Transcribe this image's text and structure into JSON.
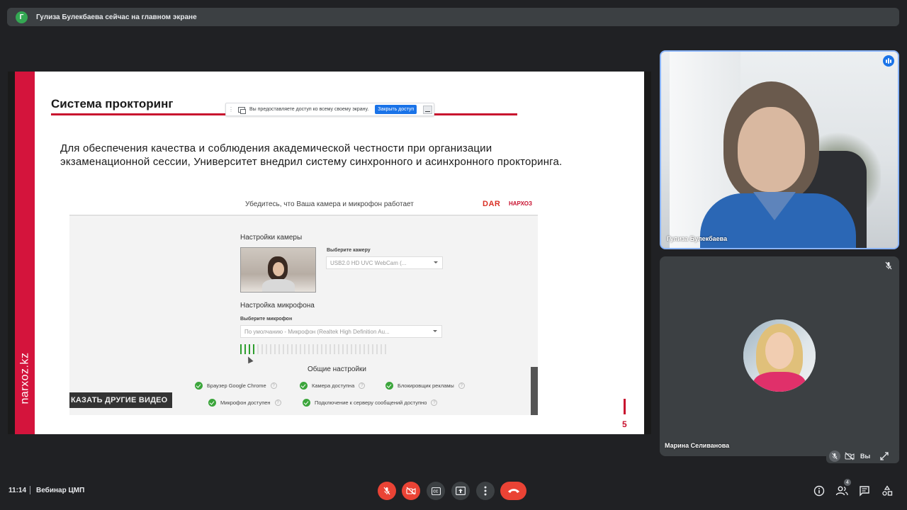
{
  "banner": {
    "avatar_letter": "Г",
    "text": "Гулиза Булекбаева сейчас на главном экране"
  },
  "share_notice": {
    "text": "Вы предоставляете доступ ко всему своему экрану.",
    "stop_label": "Закрыть доступ"
  },
  "slide": {
    "title": "Система прокторинг",
    "paragraph": "Для обеспечения качества и соблюдения академической честности при организации экзаменационной сессии, Университет внедрил систему синхронного и асинхронного прокторинга.",
    "side_text": "narxoz.kz",
    "page_number": "5",
    "embedded": {
      "header": "Убедитесь, что Ваша камера и микрофон работает",
      "logo_left": "DAR",
      "logo_right": "НАРХОЗ",
      "camera_heading": "Настройки камеры",
      "camera_select_label": "Выберите камеру",
      "camera_select_value": "USB2.0 HD UVC WebCam (...",
      "mic_heading": "Настройка микрофона",
      "mic_select_label": "Выберите микрофон",
      "mic_select_value": "По умолчанию - Микрофон (Realtek High Definition Au...",
      "general_heading": "Общие настройки",
      "checks": [
        "Браузер Google Chrome",
        "Камера доступна",
        "Блокировщик рекламы",
        "Микрофон доступен",
        "Подключение к серверу сообщений доступно"
      ],
      "show_other_button": "КАЗАТЬ ДРУГИЕ ВИДЕО",
      "mic_level_active_bars": 4,
      "mic_level_total_bars": 35
    }
  },
  "participants": [
    {
      "name": "Гулиза Булекбаева",
      "speaking": true,
      "video": true
    },
    {
      "name": "Марина Селиванова",
      "muted": true,
      "video": false
    }
  ],
  "self_tile": {
    "label": "Вы"
  },
  "bottom_bar": {
    "time": "11:14",
    "meeting_name": "Вебинар ЦМП",
    "controls": [
      "mic-off-icon",
      "camera-off-icon",
      "captions-icon",
      "present-icon",
      "more-icon",
      "end-call-icon"
    ],
    "people_count": "4"
  },
  "colors": {
    "accent_blue": "#1a73e8",
    "danger_red": "#ea4335",
    "brand_red": "#c8102e",
    "background": "#202124"
  }
}
